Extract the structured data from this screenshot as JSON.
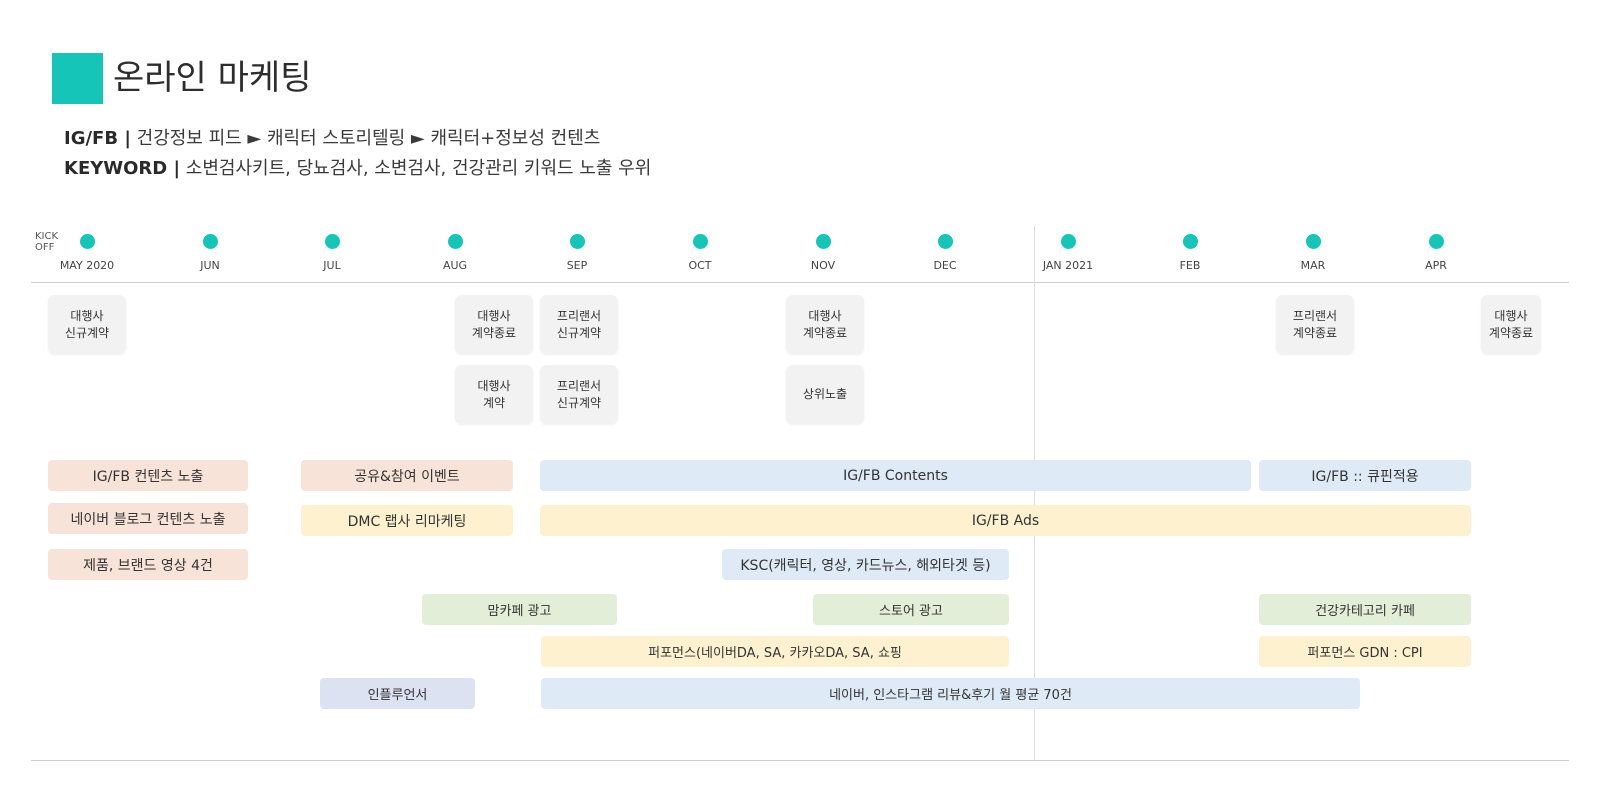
{
  "header": {
    "title": "온라인 마케팅",
    "line1_key": "IG/FB |",
    "line1_text": " 건강정보 피드 ► 캐릭터 스토리텔링 ► 캐릭터+정보성 컨텐츠",
    "line2_key": "KEYWORD |",
    "line2_text": " 소변검사키트, 당뇨검사, 소변검사, 건강관리 키워드 노출 우위"
  },
  "timeline": {
    "kickoff_label": "KICK\nOFF",
    "dot_color": "#14c5b8",
    "months": [
      "MAY 2020",
      "JUN",
      "JUL",
      "AUG",
      "SEP",
      "OCT",
      "NOV",
      "DEC",
      "JAN 2021",
      "FEB",
      "MAR",
      "APR"
    ]
  },
  "milestones": [
    "대행사\n신규계약",
    "대행사\n계약종료",
    "프리랜서\n신규계약",
    "대행사\n계약종료",
    "프리랜서\n계약종료",
    "대행사\n계약종료",
    "대행사\n계약",
    "프리랜서\n신규계약",
    "상위노출"
  ],
  "colors": {
    "peach": "#f8e3d8",
    "blue": "#deeaf6",
    "yellow": "#fef1cf",
    "green": "#e3eed8",
    "lavender": "#dde2f3"
  },
  "activities": [
    "IG/FB  컨텐츠 노출",
    "공유&참여 이벤트",
    "IG/FB Contents",
    "IG/FB :: 큐핀적용",
    "네이버 블로그 컨텐츠 노출",
    "DMC 랩사 리마케팅",
    "IG/FB Ads",
    "제품, 브랜드 영상 4건",
    "KSC(캐릭터, 영상, 카드뉴스, 해외타겟 등)",
    "맘카페 광고",
    "스토어 광고",
    "건강카테고리 카페",
    "퍼포먼스(네이버DA, SA, 카카오DA, SA, 쇼핑",
    "퍼포먼스 GDN : CPI",
    "인플루언서",
    "네이버, 인스타그램 리뷰&후기 월 평균 70건"
  ]
}
